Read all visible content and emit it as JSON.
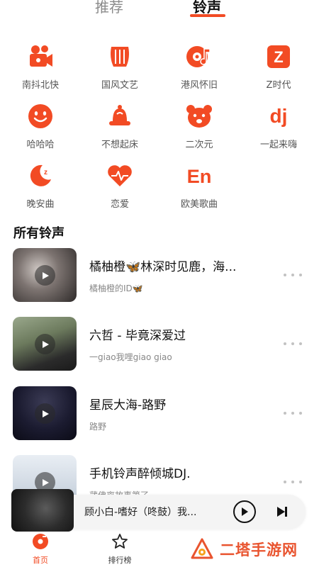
{
  "tabs": [
    {
      "label": "推荐",
      "active": false
    },
    {
      "label": "铃声",
      "active": true
    }
  ],
  "accent_color": "#f24b24",
  "categories": [
    {
      "label": "南抖北快",
      "icon": "video-camera-icon"
    },
    {
      "label": "国风文艺",
      "icon": "lyre-icon"
    },
    {
      "label": "港风怀旧",
      "icon": "vinyl-record-icon"
    },
    {
      "label": "Z时代",
      "icon": "z-badge-icon"
    },
    {
      "label": "哈哈哈",
      "icon": "smiley-face-icon"
    },
    {
      "label": "不想起床",
      "icon": "alarm-bell-icon"
    },
    {
      "label": "二次元",
      "icon": "bear-face-icon"
    },
    {
      "label": "一起来嗨",
      "icon": "dj-icon"
    },
    {
      "label": "晚安曲",
      "icon": "moon-sleep-icon"
    },
    {
      "label": "恋爱",
      "icon": "heart-pulse-icon"
    },
    {
      "label": "欧美歌曲",
      "icon": "en-icon"
    }
  ],
  "section_title": "所有铃声",
  "songs": [
    {
      "title": "橘柚橙🦋林深时见鹿，海...",
      "artist": "橘柚橙的ID🦋"
    },
    {
      "title": "六哲 - 毕竟深爱过",
      "artist": "一giao我哩giao giao"
    },
    {
      "title": "星辰大海-路野",
      "artist": "路野"
    },
    {
      "title": "手机铃声醉倾城DJ.",
      "artist": "蒲佛离故事第了"
    }
  ],
  "player": {
    "title": "顾小白-嗜好（咚鼓）我..."
  },
  "nav": {
    "home": "首页",
    "rank": "排行榜"
  },
  "watermark": {
    "text": "二塔手游网"
  }
}
